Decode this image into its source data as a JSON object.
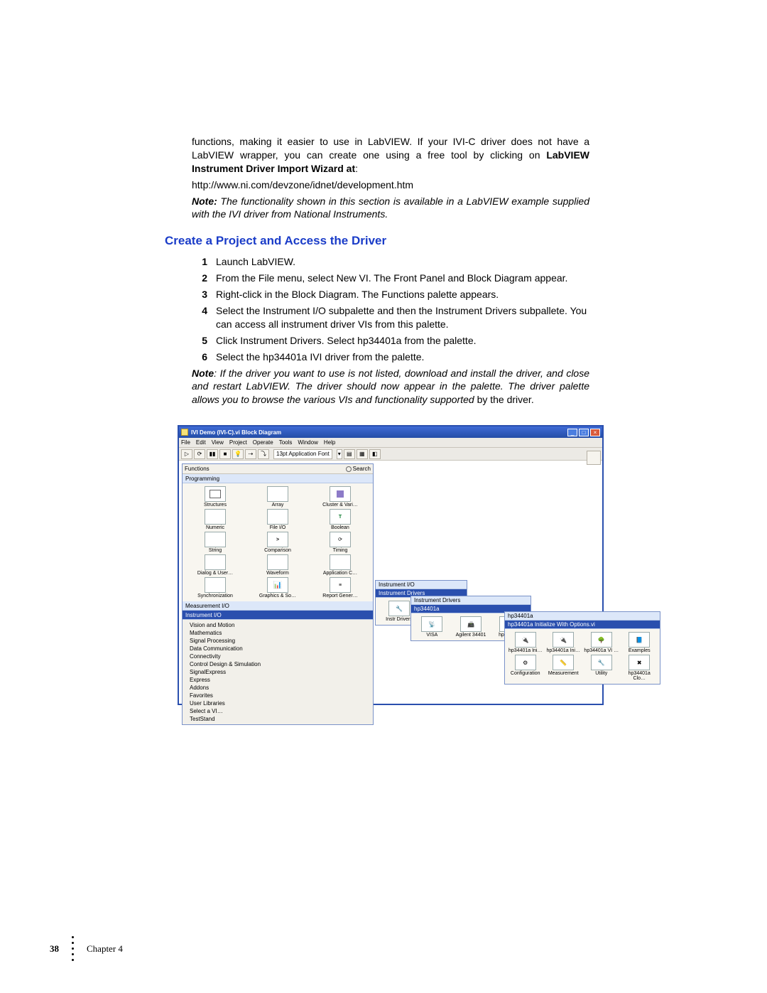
{
  "intro": {
    "p1a": "functions, making it easier to use in LabVIEW. If your IVI-C driver does not have a LabVIEW wrapper, you can create one using a free tool by clicking on ",
    "p1b": "LabVIEW Instrument Driver Import Wizard at",
    "p1c": ":",
    "url": "http://www.ni.com/devzone/idnet/development.htm",
    "noteLabel": "Note:",
    "noteBody": " The functionality shown in this section is available in a LabVIEW example supplied with the IVI driver from National Instruments."
  },
  "heading": "Create a Project and Access the Driver",
  "steps": [
    {
      "n": "1",
      "t": "Launch LabVIEW."
    },
    {
      "n": "2",
      "t": "From the File menu, select New VI.  The Front Panel and Block Diagram appear."
    },
    {
      "n": "3",
      "t": "Right-click in the Block Diagram. The Functions palette appears."
    },
    {
      "n": "4",
      "t": "Select the Instrument I/O subpalette and then the Instrument Drivers subpallete. You can access all instrument driver VIs from this palette."
    },
    {
      "n": "5",
      "t": "Click Instrument Drivers. Select hp34401a from the palette."
    },
    {
      "n": "6",
      "t": "Select the hp34401a IVI driver from the palette."
    }
  ],
  "note2": {
    "label": "Note",
    "italic": ": If the driver you want to use is not listed, download and install the driver, and close and restart LabVIEW. The driver should now appear in the palette. The driver palette allows you to browse the various VIs and functionality supported ",
    "tail": "by the driver."
  },
  "window": {
    "title": "IVI Demo (IVI-C).vi Block Diagram",
    "menus": [
      "File",
      "Edit",
      "View",
      "Project",
      "Operate",
      "Tools",
      "Window",
      "Help"
    ],
    "font": "13pt Application Font",
    "palette": {
      "title": "Functions",
      "search": "Search",
      "row_prog": "Programming",
      "cells": [
        "Structures",
        "Array",
        "Cluster & Vari…",
        "Numeric",
        "File I/O",
        "Boolean",
        "String",
        "Comparison",
        "Timing",
        "Dialog & User…",
        "Waveform",
        "Application C…",
        "Synchronization",
        "Graphics & So…",
        "Report Gener…"
      ],
      "row_meas": "Measurement I/O",
      "row_inst": "Instrument I/O",
      "list": [
        "Vision and Motion",
        "Mathematics",
        "Signal Processing",
        "Data Communication",
        "Connectivity",
        "Control Design & Simulation",
        "SignalExpress",
        "Express",
        "Addons",
        "Favorites",
        "User Libraries",
        "Select a VI…",
        "TestStand"
      ]
    },
    "sub1": {
      "hd1": "Instrument I/O",
      "hd2": "Instrument Drivers",
      "items": [
        "Instr Drivers",
        ""
      ]
    },
    "sub2": {
      "hd1": "Instrument Drivers",
      "hd2": "hp34401a",
      "items": [
        "VISA",
        "Agilent 34401",
        "hp34401a"
      ]
    },
    "sub3": {
      "hd1": "hp34401a",
      "hd2": "hp34401a Initialize With Options.vi",
      "row1": [
        "hp34401a Ini…",
        "hp34401a Ini…",
        "hp34401a VI …",
        "Examples"
      ],
      "row2": [
        "Configuration",
        "Measurement",
        "Utility",
        "hp34401a Clo…"
      ]
    }
  },
  "footer": {
    "page": "38",
    "chapter": "Chapter 4"
  }
}
